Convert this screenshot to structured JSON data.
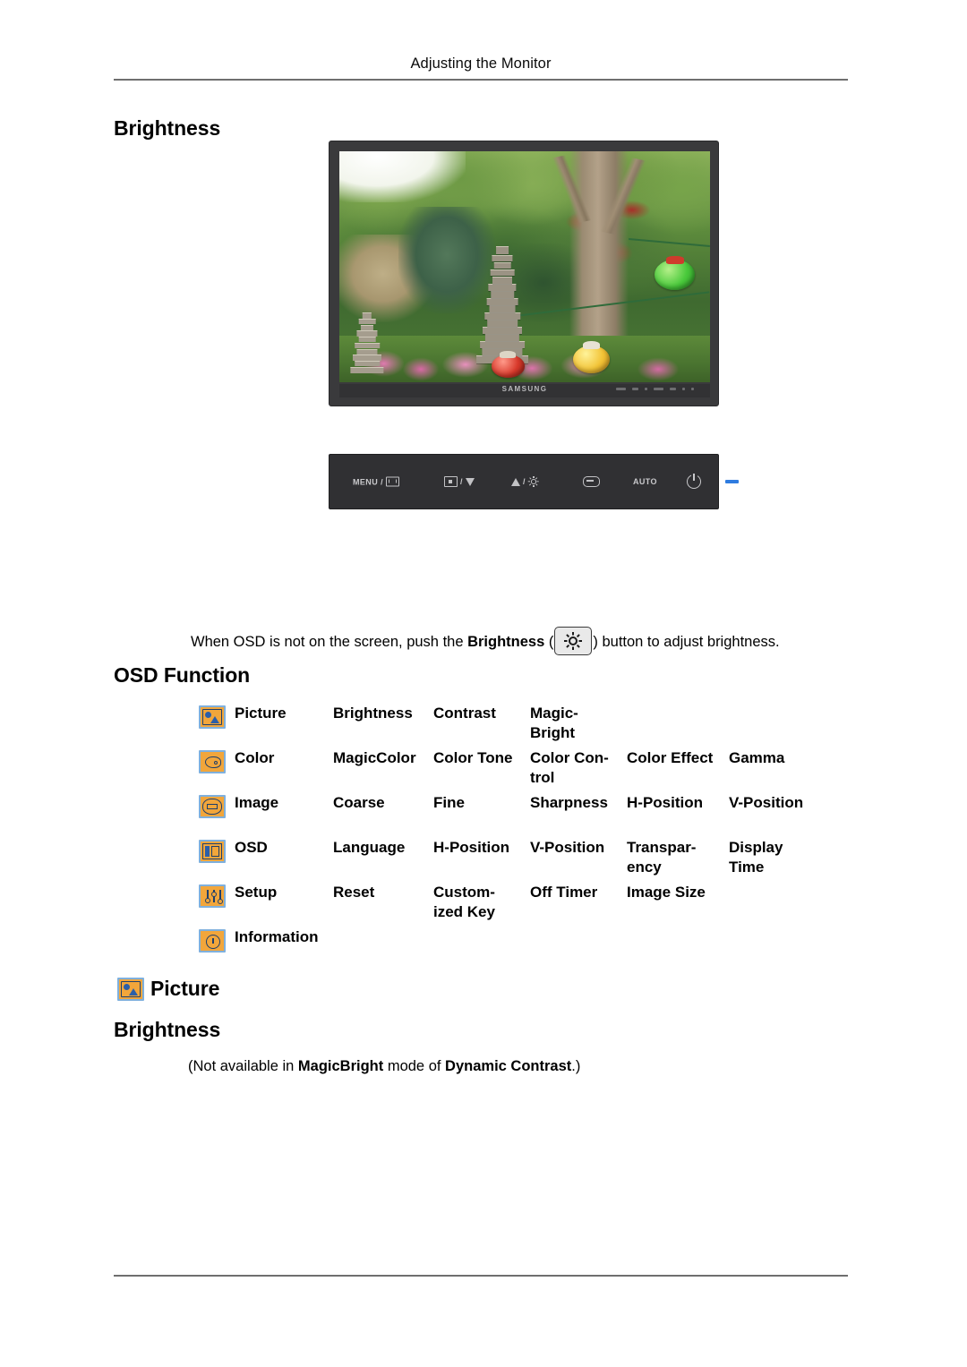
{
  "header": {
    "title": "Adjusting the Monitor"
  },
  "sections": {
    "brightness_heading": "Brightness",
    "osd_function_heading": "OSD Function",
    "picture_heading": "Picture",
    "brightness_heading_2": "Brightness"
  },
  "monitor_figure": {
    "brand": "SAMSUNG",
    "screen_description": "Garden scene with stone pagodas, trees and colored lanterns"
  },
  "control_panel": {
    "buttons": [
      {
        "name": "menu-button",
        "label": "MENU"
      },
      {
        "name": "source-down-button",
        "label": ""
      },
      {
        "name": "brightness-up-button",
        "label": ""
      },
      {
        "name": "enter-button",
        "label": ""
      },
      {
        "name": "auto-button",
        "label": "AUTO"
      },
      {
        "name": "power-button",
        "label": ""
      },
      {
        "name": "power-led",
        "label": ""
      }
    ],
    "menu_label": "MENU",
    "auto_label": "AUTO",
    "led_color": "#2f7ce0"
  },
  "caption": {
    "part1": "When OSD is not on the screen, push the ",
    "bold": "Brightness",
    "paren_open": " (",
    "paren_close": ") ",
    "part2": "button to adjust brightness."
  },
  "osd_table": {
    "rows": [
      {
        "icon": "picture-icon",
        "label": "Picture",
        "items": [
          "Brightness",
          "Contrast",
          "Magic-Bright",
          "",
          ""
        ]
      },
      {
        "icon": "color-icon",
        "label": "Color",
        "items": [
          "MagicColor",
          "Color Tone",
          "Color  Con-trol",
          "Color Effect",
          "Gamma"
        ]
      },
      {
        "icon": "image-icon",
        "label": "Image",
        "items": [
          "Coarse",
          "Fine",
          "Sharpness",
          "H-Position",
          "V-Position"
        ]
      },
      {
        "icon": "osd-icon",
        "label": "OSD",
        "items": [
          "Language",
          "H-Position",
          "V-Position",
          "Transpar-ency",
          "Display Time"
        ]
      },
      {
        "icon": "setup-icon",
        "label": "Setup",
        "items": [
          "Reset",
          "Custom-ized Key",
          "Off Timer",
          "Image Size",
          ""
        ]
      },
      {
        "icon": "information-icon",
        "label": "Information",
        "items": [
          "",
          "",
          "",
          "",
          ""
        ]
      }
    ]
  },
  "note": {
    "part1": "(Not available in ",
    "bold1": "MagicBright",
    "part2": " mode of ",
    "bold2": "Dynamic Contrast",
    "part3": ".)"
  },
  "colors": {
    "icon_fill": "#f2a63b",
    "icon_border": "#7fb0dd",
    "icon_glyph": "#1f3f6b",
    "rule": "#6f6f6f",
    "bezel": "#3a3a3c",
    "panel": "#303033"
  }
}
